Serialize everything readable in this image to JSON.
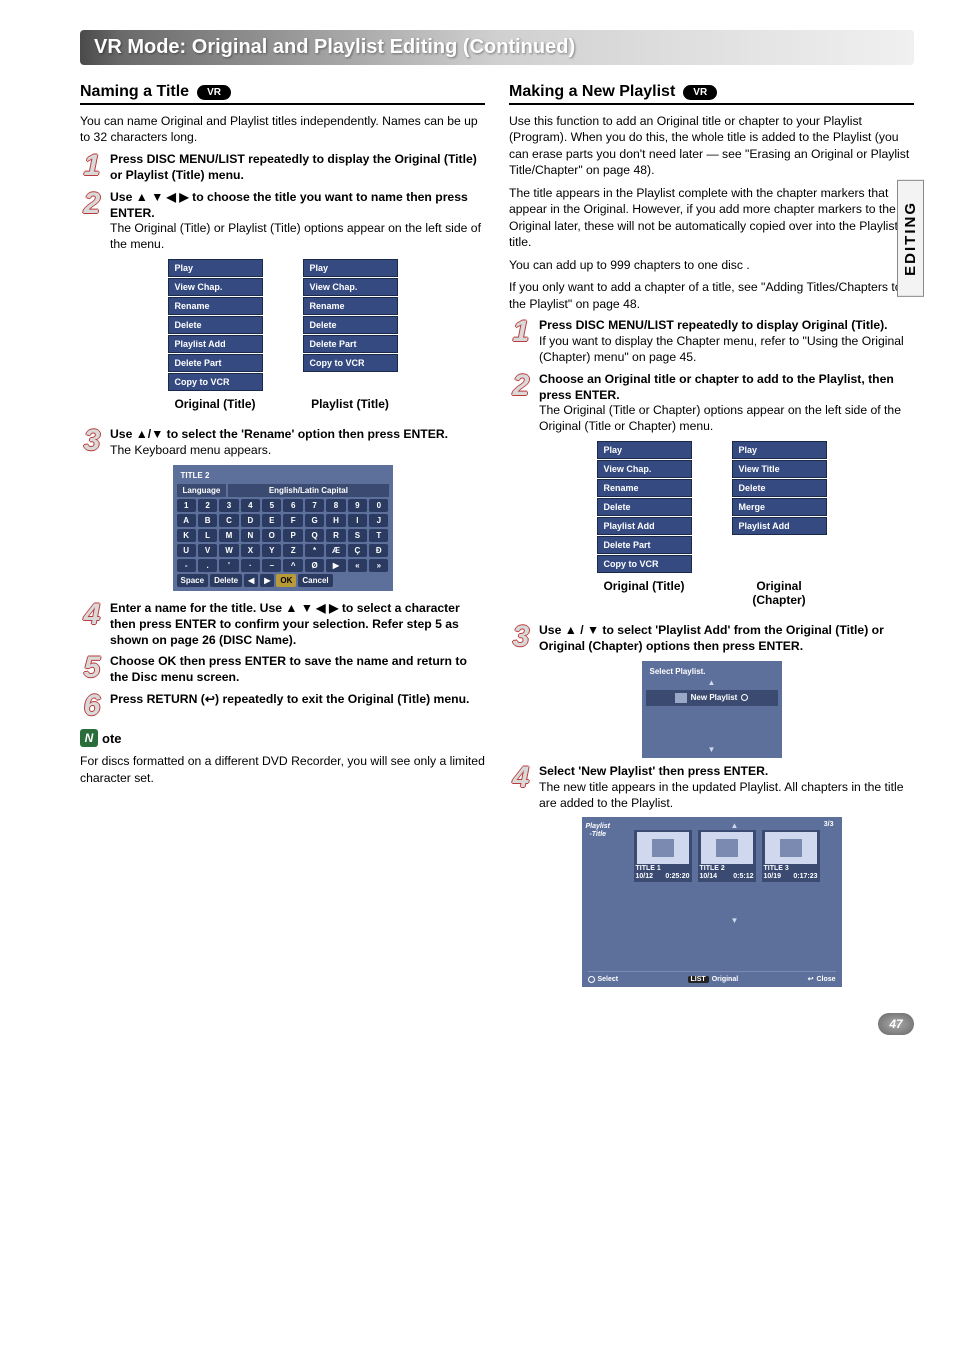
{
  "banner": "VR Mode: Original and Playlist Editing (Continued)",
  "side_tab": "EDITING",
  "page_number": "47",
  "vr_badge": "VR",
  "left": {
    "title": "Naming a Title",
    "intro": "You can name Original and Playlist titles independently. Names can be up to 32 characters long.",
    "steps": {
      "s1": {
        "n": "1",
        "hdr": "Press DISC MENU/LIST repeatedly to display the Original (Title) or Playlist (Title) menu."
      },
      "s2": {
        "n": "2",
        "hdr": "Use ▲ ▼ ◀ ▶ to choose the title you want to name then press ENTER.",
        "body": "The Original (Title) or Playlist (Title) options appear on the left side of the menu."
      },
      "s3": {
        "n": "3",
        "hdr": "Use ▲/▼ to select the 'Rename' option then press ENTER.",
        "body": "The Keyboard menu appears."
      },
      "s4": {
        "n": "4",
        "hdr": "Enter a name for the title. Use ▲ ▼ ◀ ▶ to select a character then press ENTER to confirm your selection. Refer step 5 as shown on page 26 (DISC Name)."
      },
      "s5": {
        "n": "5",
        "hdr": "Choose OK then press ENTER to save the name and return to the Disc menu screen."
      },
      "s6": {
        "n": "6",
        "hdr": "Press RETURN (↩) repeatedly to exit the Original (Title) menu."
      }
    },
    "menu_original": [
      "Play",
      "View Chap.",
      "Rename",
      "Delete",
      "Playlist Add",
      "Delete Part",
      "Copy to VCR"
    ],
    "menu_playlist": [
      "Play",
      "View Chap.",
      "Rename",
      "Delete",
      "Delete Part",
      "Copy to VCR"
    ],
    "menu_cap_original": "Original (Title)",
    "menu_cap_playlist": "Playlist (Title)",
    "keyboard": {
      "title": "TITLE 2",
      "lang": "Language",
      "mode": "English/Latin Capital",
      "row1": [
        "1",
        "2",
        "3",
        "4",
        "5",
        "6",
        "7",
        "8",
        "9",
        "0"
      ],
      "row2": [
        "A",
        "B",
        "C",
        "D",
        "E",
        "F",
        "G",
        "H",
        "I",
        "J"
      ],
      "row3": [
        "K",
        "L",
        "M",
        "N",
        "O",
        "P",
        "Q",
        "R",
        "S",
        "T"
      ],
      "row4": [
        "U",
        "V",
        "W",
        "X",
        "Y",
        "Z",
        "*",
        "Æ",
        "Ç",
        "Đ"
      ],
      "row5": [
        "-",
        ".",
        "'",
        "·",
        "–",
        "^",
        "Ø",
        "▶",
        "«",
        "»"
      ],
      "bottom": {
        "space": "Space",
        "delete": "Delete",
        "left": "◀",
        "right": "▶",
        "ok": "OK",
        "cancel": "Cancel"
      }
    },
    "note_label": "ote",
    "note_body": "For discs formatted on a different DVD Recorder, you will see only a limited character set."
  },
  "right": {
    "title": "Making a New Playlist",
    "p1": "Use this function to add an Original title or chapter to your Playlist (Program). When you do this, the whole title is added to the Playlist (you can erase parts you don't need later — see \"Erasing an Original or Playlist Title/Chapter\" on page 48).",
    "p2": "The title appears in the Playlist complete with the chapter markers that appear in the Original. However, if you add more chapter markers to the Original later, these will not be automatically copied over into the Playlist title.",
    "p3a": "You can add up to 999 chapters to one disc .",
    "p3b": "If you only want to add a chapter of a title, see \"Adding Titles/Chapters to the Playlist\" on page 48.",
    "steps": {
      "s1": {
        "n": "1",
        "hdr": "Press DISC MENU/LIST repeatedly to display Original (Title).",
        "body": "If you want to display the Chapter menu, refer to \"Using the Original (Chapter) menu\" on page 45."
      },
      "s2": {
        "n": "2",
        "hdr": "Choose an Original title or chapter to add to the Playlist, then press ENTER.",
        "body": "The Original (Title or Chapter) options appear on the left side of the Original (Title or Chapter) menu."
      },
      "s3": {
        "n": "3",
        "hdr": "Use ▲ / ▼ to select 'Playlist Add' from the Original (Title) or Original (Chapter) options then press ENTER."
      },
      "s4": {
        "n": "4",
        "hdr": "Select 'New Playlist' then press ENTER.",
        "body": "The new title appears in the updated Playlist. All chapters in the title are added to the Playlist."
      }
    },
    "menu_original": [
      "Play",
      "View Chap.",
      "Rename",
      "Delete",
      "Playlist Add",
      "Delete Part",
      "Copy to VCR"
    ],
    "menu_chapter": [
      "Play",
      "View Title",
      "Delete",
      "Merge",
      "Playlist Add"
    ],
    "menu_cap_original": "Original (Title)",
    "menu_cap_chapter": "Original (Chapter)",
    "select_playlist": {
      "header": "Select Playlist.",
      "row": "New Playlist"
    },
    "playlist_title": {
      "side1": "Playlist",
      "side2": "-Title",
      "counter": "3/3",
      "thumbs": [
        {
          "name": "TITLE 1",
          "date": "10/12",
          "dur": "0:25:20"
        },
        {
          "name": "TITLE 2",
          "date": "10/14",
          "dur": "0:5:12"
        },
        {
          "name": "TITLE 3",
          "date": "10/19",
          "dur": "0:17:23"
        }
      ],
      "bottom": {
        "select": "Select",
        "list": "LIST",
        "original": "Original",
        "close": "Close"
      }
    }
  }
}
